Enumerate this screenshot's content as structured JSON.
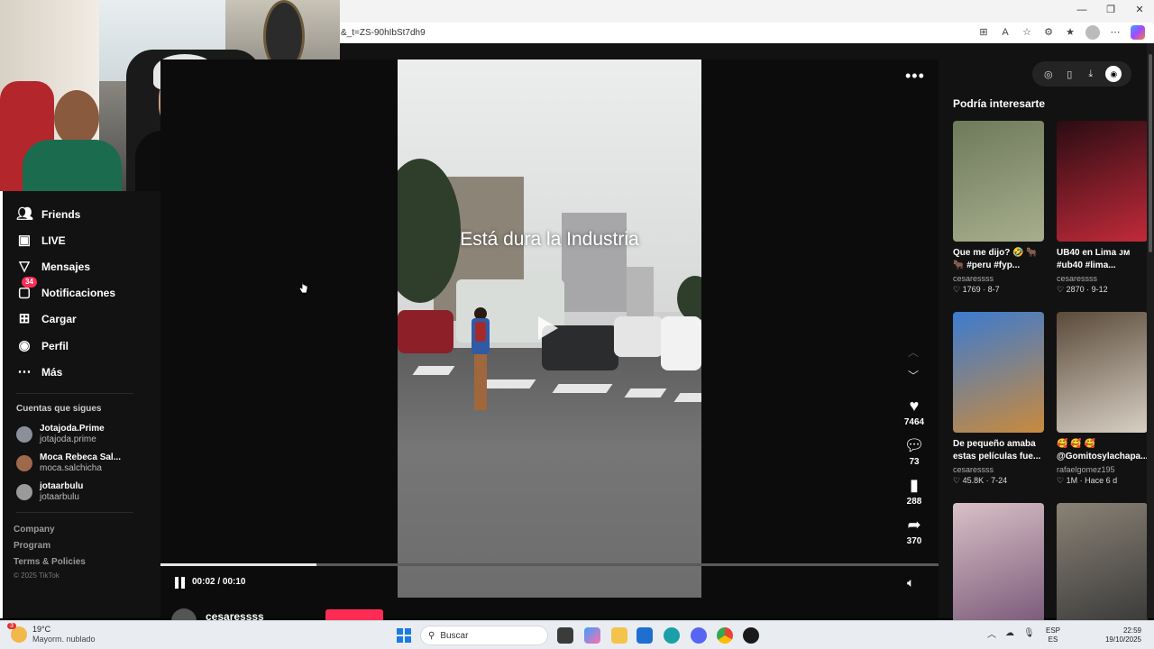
{
  "browser": {
    "url": "&_t=ZS-90hIbSt7dh9",
    "window_controls": [
      "—",
      "❐",
      "✕"
    ]
  },
  "sidebar": {
    "items": [
      {
        "label": "Friends",
        "icon": "friends-icon"
      },
      {
        "label": "LIVE",
        "icon": "live-icon"
      },
      {
        "label": "Mensajes",
        "icon": "messages-icon"
      },
      {
        "label": "Notificaciones",
        "icon": "notifications-icon",
        "badge": "34"
      },
      {
        "label": "Cargar",
        "icon": "upload-icon"
      },
      {
        "label": "Perfil",
        "icon": "profile-icon"
      },
      {
        "label": "Más",
        "icon": "more-icon"
      }
    ],
    "following_title": "Cuentas que sigues",
    "following": [
      {
        "name": "Jotajoda.Prime",
        "handle": "jotajoda.prime"
      },
      {
        "name": "Moca Rebeca Sal...",
        "handle": "moca.salchicha"
      },
      {
        "name": "jotaarbulu",
        "handle": "jotaarbulu"
      }
    ],
    "footer_links": [
      "Company",
      "Program",
      "Terms & Policies"
    ],
    "copyright": "© 2025 TikTok"
  },
  "player": {
    "caption": "Está dura la Industria",
    "likes": "7464",
    "comments": "73",
    "saves": "288",
    "shares": "370",
    "time": "00:02 / 00:10",
    "progress": 0.2,
    "author": "cesaressss"
  },
  "recommendations": {
    "title": "Podría interesarte",
    "items": [
      {
        "title": "Que me dijo? 🤣 🐂 🐂 #peru #fyp...",
        "author": "cesaressss",
        "likes": "1769",
        "date": "8-7",
        "colors": [
          "#6e7a5a",
          "#a7ae8e"
        ]
      },
      {
        "title": "UB40 en Lima ᴊᴍ #ub40 #lima...",
        "author": "cesaressss",
        "likes": "2870",
        "date": "9-12",
        "colors": [
          "#2a0c12",
          "#c22a3a"
        ]
      },
      {
        "title": "De pequeño amaba estas películas fue...",
        "author": "cesaressss",
        "likes": "45.8K",
        "date": "7-24",
        "colors": [
          "#3c7bd0",
          "#c98a3d"
        ]
      },
      {
        "title": "🥰 🥰 🥰 @Gomitosylachapa...",
        "author": "rafaelgomez195",
        "likes": "1M",
        "date": "Hace 6 d",
        "colors": [
          "#5a4a3a",
          "#d8d0c4"
        ]
      },
      {
        "title": "",
        "author": "",
        "likes": "",
        "date": "",
        "colors": [
          "#d9c0c6",
          "#7a5a7a"
        ]
      },
      {
        "title": "",
        "author": "",
        "likes": "",
        "date": "",
        "colors": [
          "#8a8275",
          "#3a3a3a"
        ]
      }
    ]
  },
  "taskbar": {
    "weather_temp": "19°C",
    "weather_desc": "Mayorm. nublado",
    "weather_badge": "3",
    "search_placeholder": "Buscar",
    "lang_top": "ESP",
    "lang_bottom": "ES",
    "time": "22:59",
    "date": "19/10/2025"
  }
}
